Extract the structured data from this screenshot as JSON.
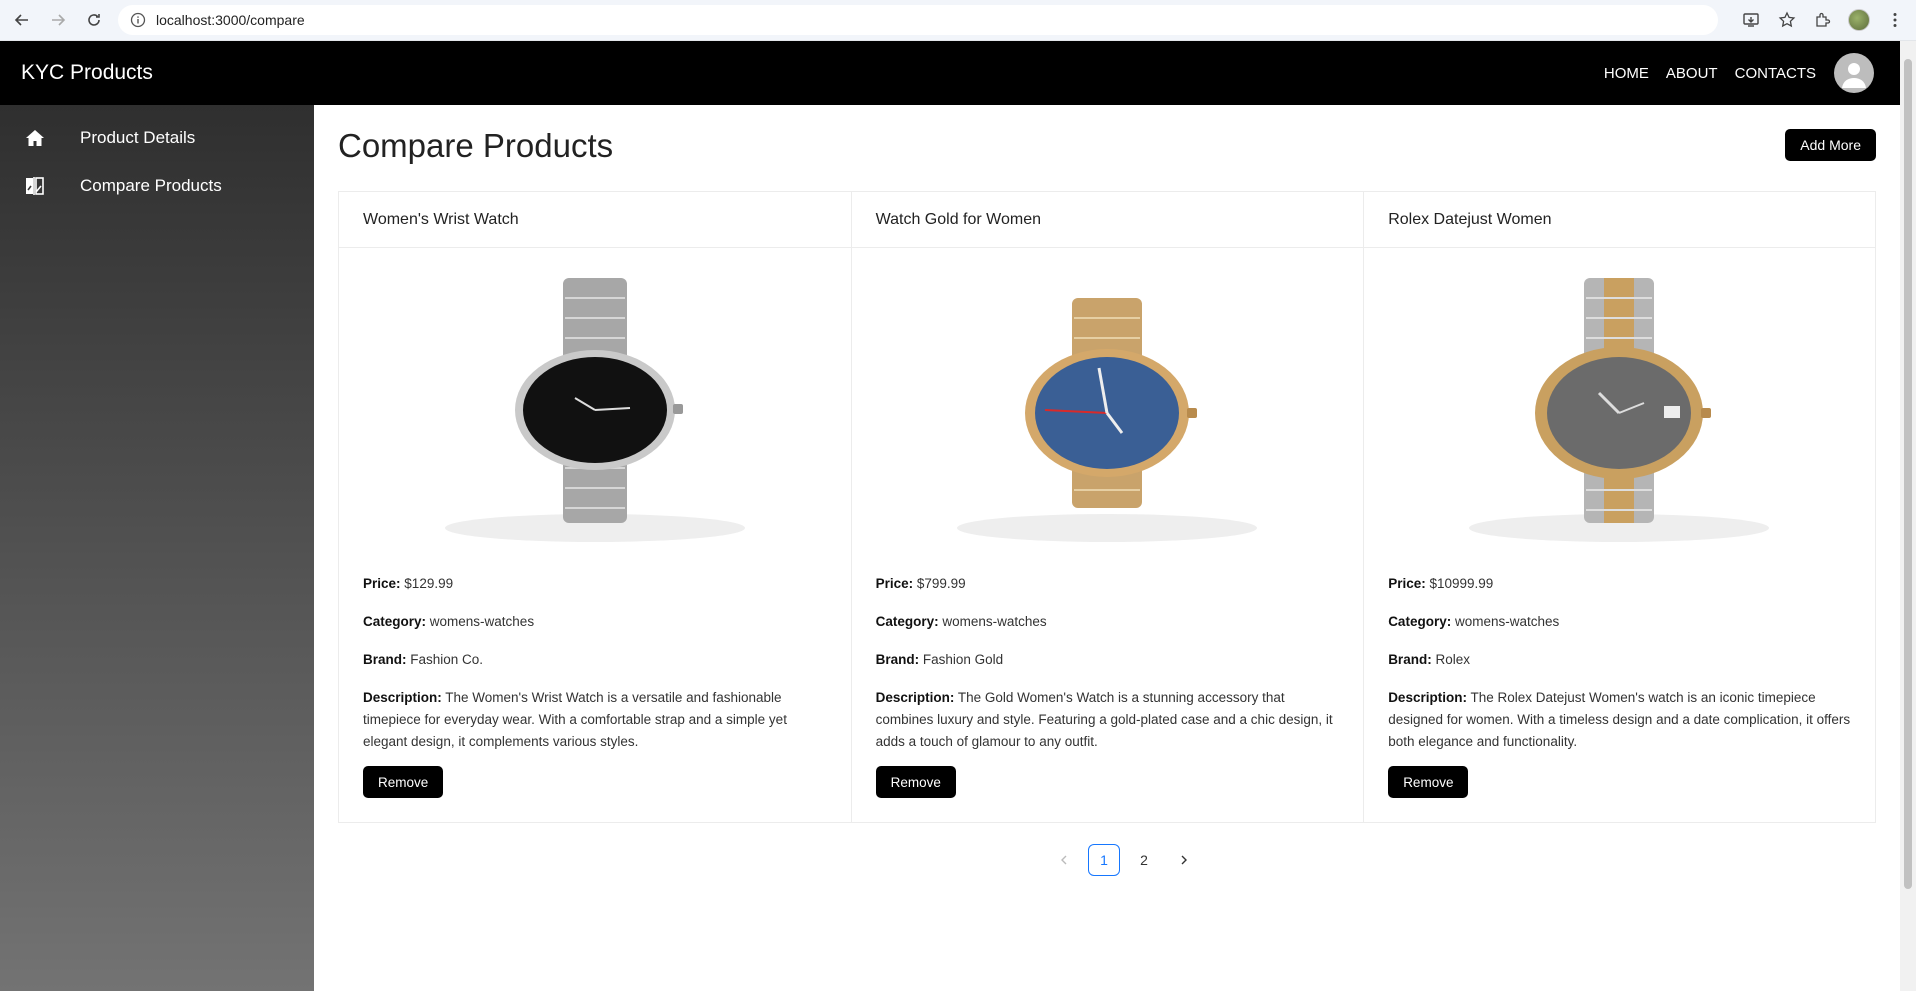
{
  "browser": {
    "url": "localhost:3000/compare"
  },
  "header": {
    "brand": "KYC Products",
    "nav": [
      "HOME",
      "ABOUT",
      "CONTACTS"
    ]
  },
  "sidebar": {
    "items": [
      {
        "label": "Product Details",
        "icon": "home-icon"
      },
      {
        "label": "Compare Products",
        "icon": "compare-icon"
      }
    ]
  },
  "main": {
    "title": "Compare Products",
    "add_more_label": "Add More",
    "labels": {
      "price": "Price:",
      "category": "Category:",
      "brand": "Brand:",
      "description": "Description:"
    },
    "remove_label": "Remove",
    "products": [
      {
        "title": "Women's Wrist Watch",
        "price": "$129.99",
        "category": "womens-watches",
        "brand": "Fashion Co.",
        "description": "The Women's Wrist Watch is a versatile and fashionable timepiece for everyday wear. With a comfortable strap and a simple yet elegant design, it complements various styles.",
        "image": "silver-watch-black-dial"
      },
      {
        "title": "Watch Gold for Women",
        "price": "$799.99",
        "category": "womens-watches",
        "brand": "Fashion Gold",
        "description": "The Gold Women's Watch is a stunning accessory that combines luxury and style. Featuring a gold-plated case and a chic design, it adds a touch of glamour to any outfit.",
        "image": "gold-watch-blue-dial"
      },
      {
        "title": "Rolex Datejust Women",
        "price": "$10999.99",
        "category": "womens-watches",
        "brand": "Rolex",
        "description": "The Rolex Datejust Women's watch is an iconic timepiece designed for women. With a timeless design and a date complication, it offers both elegance and functionality.",
        "image": "two-tone-watch-grey-dial"
      }
    ]
  },
  "pagination": {
    "pages": [
      "1",
      "2"
    ],
    "current": "1"
  },
  "colors": {
    "appbar": "#000000",
    "sidebar_top": "#2f2f2f",
    "sidebar_bottom": "#737373",
    "accent": "#1677ff"
  }
}
